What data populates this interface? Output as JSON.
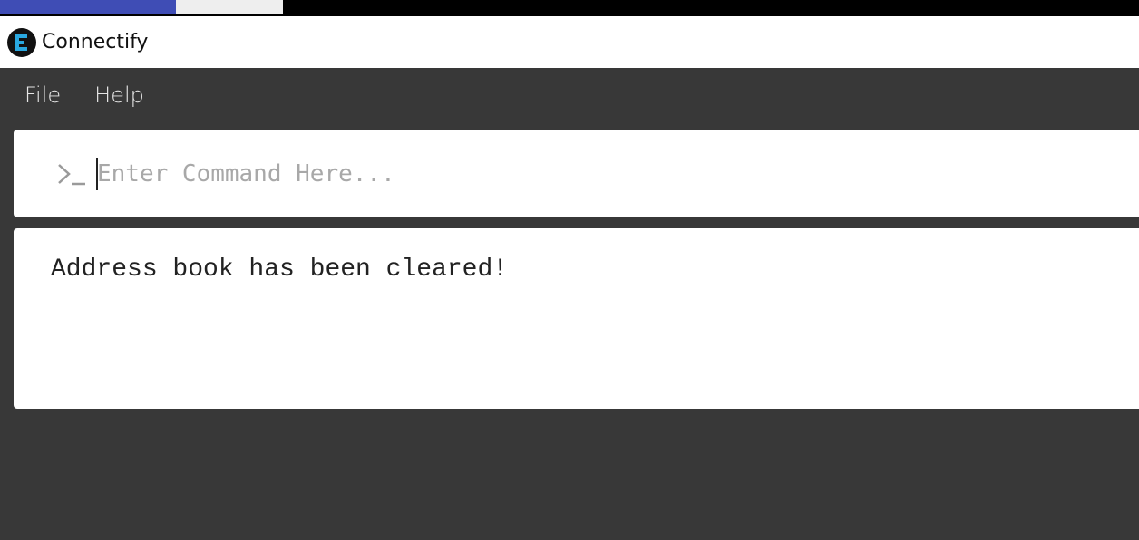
{
  "window": {
    "title": "Connectify",
    "icon": "connectify-logo-icon"
  },
  "menu": {
    "items": [
      {
        "label": "File"
      },
      {
        "label": "Help"
      }
    ]
  },
  "command": {
    "placeholder": "Enter Command Here...",
    "value": "",
    "icon": "terminal-prompt-icon"
  },
  "result": {
    "message": "Address book has been cleared!"
  },
  "colors": {
    "background": "#383838",
    "panel": "#ffffff",
    "menu_text": "#e6e6e6",
    "placeholder": "#a8a8a8"
  }
}
